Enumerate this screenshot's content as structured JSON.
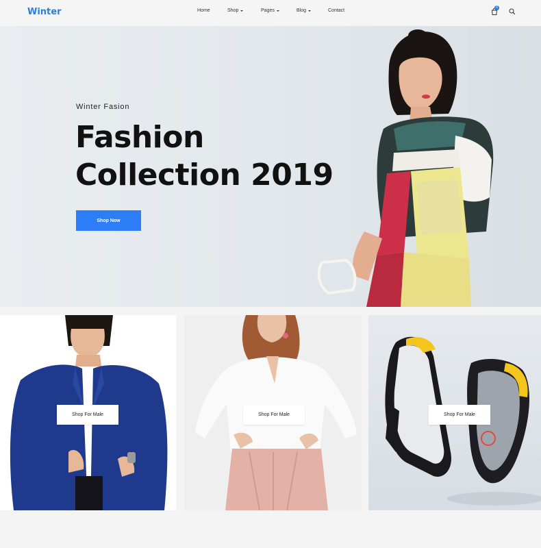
{
  "brand": {
    "logo": "Winter",
    "accent": "#2a7de1",
    "button_color": "#2d7df6"
  },
  "nav": {
    "items": [
      {
        "label": "Home",
        "has_dropdown": false
      },
      {
        "label": "Shop",
        "has_dropdown": true
      },
      {
        "label": "Pages",
        "has_dropdown": true
      },
      {
        "label": "Blog",
        "has_dropdown": true
      },
      {
        "label": "Contact",
        "has_dropdown": false
      }
    ],
    "cart_count": "0",
    "icons": [
      "shopping-bag-icon",
      "search-icon"
    ]
  },
  "hero": {
    "eyebrow": "Winter Fasion",
    "title_line1": "Fashion",
    "title_line2": "Collection 2019",
    "cta_label": "Shop Now"
  },
  "categories": [
    {
      "button_label": "Shop For Male",
      "image": "man-in-blue-blazer"
    },
    {
      "button_label": "Shop For Male",
      "image": "woman-in-white-shirt"
    },
    {
      "button_label": "Shop For Male",
      "image": "sneakers"
    }
  ]
}
